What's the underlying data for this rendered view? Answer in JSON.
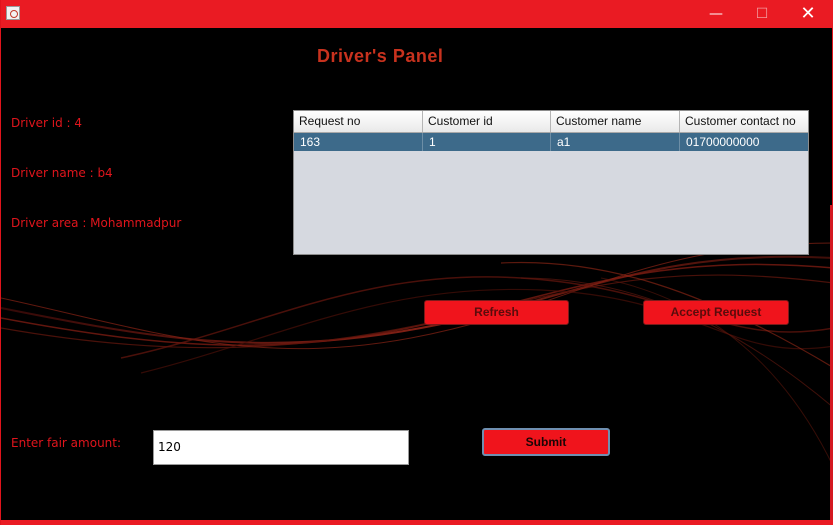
{
  "titlebar": {
    "minimize_icon": "minimize-icon",
    "maximize_icon": "maximize-icon",
    "close_icon": "close-icon",
    "minimize_glyph": "—",
    "maximize_glyph": "☐",
    "close_glyph": "✕"
  },
  "panel": {
    "title": "Driver's Panel",
    "driver_id": "Driver id : 4",
    "driver_name": "Driver name : b4",
    "driver_area": "Driver area : Mohammadpur"
  },
  "table": {
    "columns": [
      "Request no",
      "Customer id",
      "Customer name",
      "Customer contact no"
    ],
    "rows": [
      [
        "163",
        "1",
        "a1",
        "01700000000"
      ]
    ]
  },
  "buttons": {
    "refresh": "Refresh",
    "accept": "Accept Request",
    "submit": "Submit"
  },
  "fare": {
    "label": "Enter fair amount:",
    "value": "120"
  },
  "colors": {
    "title_bar": "#ea1b23",
    "accent": "#f0141c",
    "selected_row": "#3d6a8a"
  }
}
